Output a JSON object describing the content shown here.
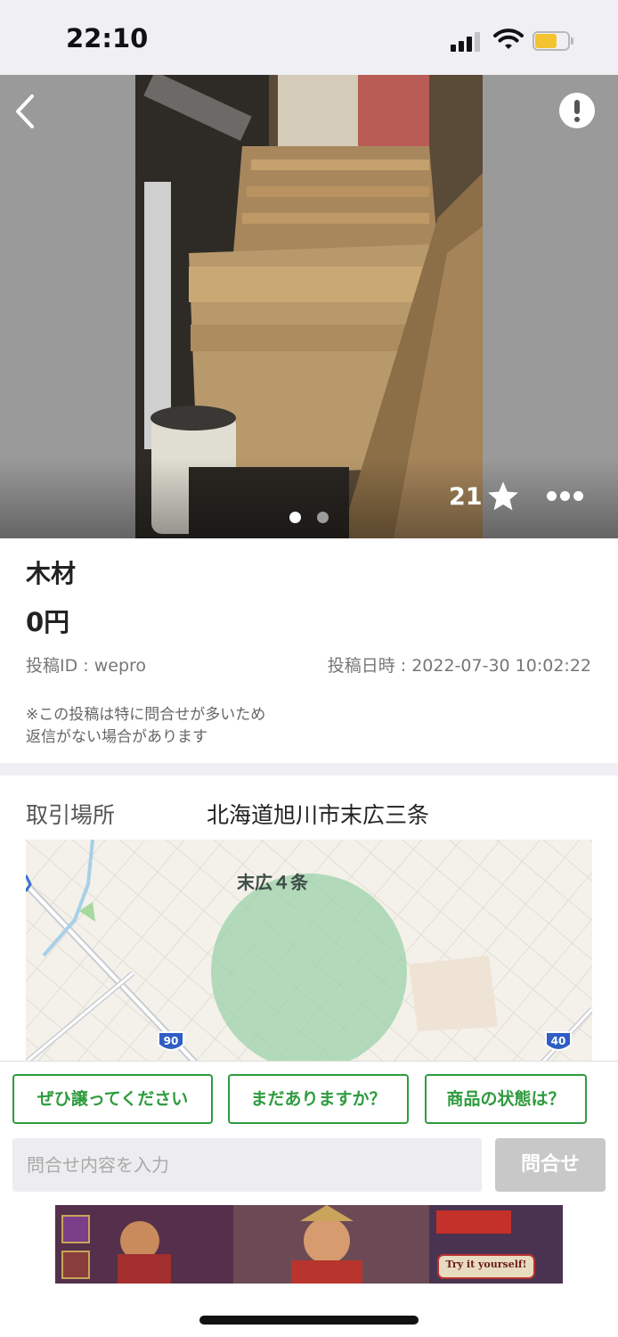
{
  "status_bar": {
    "time": "22:10"
  },
  "photo": {
    "favorite_count": "21",
    "current_index": 1,
    "total": 2
  },
  "item": {
    "title": "木材",
    "price": "0円",
    "post_id": "投稿ID : wepro",
    "post_date": "投稿日時 : 2022-07-30 10:02:22",
    "notice_line1": "※この投稿は特に問合せが多いため",
    "notice_line2": "返信がない場合があります"
  },
  "location": {
    "label": "取引場所",
    "value": "北海道旭川市末広三条",
    "map_label": "末広４条",
    "route_90": "90",
    "route_40": "40"
  },
  "quick_replies": [
    "ぜひ譲ってください",
    "まだありますか？",
    "商品の状態は？"
  ],
  "inquiry": {
    "placeholder": "問合せ内容を入力",
    "send_label": "問合せ"
  },
  "ad": {
    "cta": "Try it yourself!"
  },
  "colors": {
    "accent_green": "#2f9b3f",
    "area_circle": "#8fce9f"
  }
}
